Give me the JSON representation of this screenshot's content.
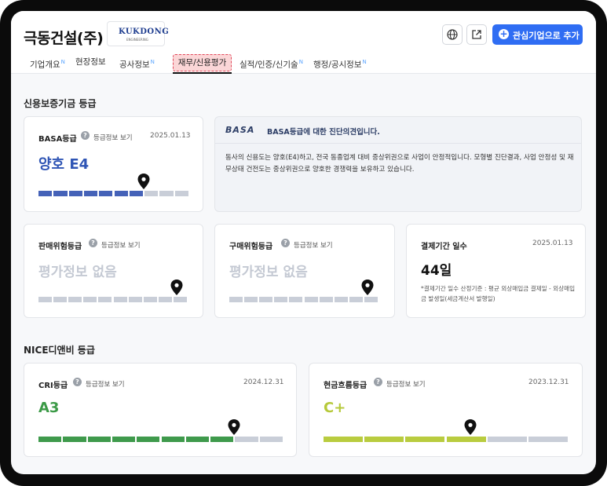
{
  "header": {
    "company_name": "극동건설(주)",
    "logo_text": "KUKDONG",
    "logo_sub": "ENGINEERING",
    "add_button_label": "관심기업으로 추가"
  },
  "tabs": [
    {
      "label": "기업개요",
      "badge": "N"
    },
    {
      "label": "현장정보",
      "badge": ""
    },
    {
      "label": "공사정보",
      "badge": "N"
    },
    {
      "label": "재무/신용평가",
      "badge": "",
      "active": true
    },
    {
      "label": "실적/인증/신기술",
      "badge": "N"
    },
    {
      "label": "행정/공시정보",
      "badge": "N"
    }
  ],
  "sections": {
    "guarantee": "신용보증기금 등급",
    "nice": "NICE디앤비 등급"
  },
  "info_link_label": "등급정보 보기",
  "basa": {
    "title": "BASA등급",
    "date": "2025.01.13",
    "grade": "양호 E4",
    "level": 0.7,
    "segments": 10,
    "grade_color": "#2f55b5"
  },
  "basa_opinion": {
    "logo": "BASA",
    "heading": "BASA등급에 대한 진단의견입니다.",
    "body": "동사의 신용도는 양호(E4)하고, 전국 동종업계 대비 중상위권으로 사업이 안정적입니다. 모형별 진단결과, 사업 안정성 및 재무상태 건전도는 중상위권으로 양호한 경쟁력을 보유하고 있습니다."
  },
  "sales_risk": {
    "title": "판매위험등급",
    "grade": "평가정보 없음"
  },
  "purchase_risk": {
    "title": "구매위험등급",
    "grade": "평가정보 없음"
  },
  "payment_days": {
    "title": "결제기간 일수",
    "date": "2025.01.13",
    "value": "44일",
    "note": "*결제기간 일수 산정기준 : 평균 외상매입금 결제일 - 외상매입금 발생일(세금계산서 발행일)"
  },
  "cri": {
    "title": "CRI등급",
    "date": "2024.12.31",
    "grade": "A3",
    "level": 0.8,
    "segments": 10,
    "grade_color": "#3c9a47"
  },
  "cashflow": {
    "title": "현금흐름등급",
    "date": "2023.12.31",
    "grade": "C+",
    "level": 0.6,
    "segments": 6,
    "grade_color": "#b6c93a"
  },
  "colors": {
    "accent": "#2f6df3",
    "bar_empty": "#c9ced8",
    "basa_fill": "#4562b8",
    "cri_fill": "#3f9a4c",
    "cash_fill": "#b9cc3f"
  }
}
